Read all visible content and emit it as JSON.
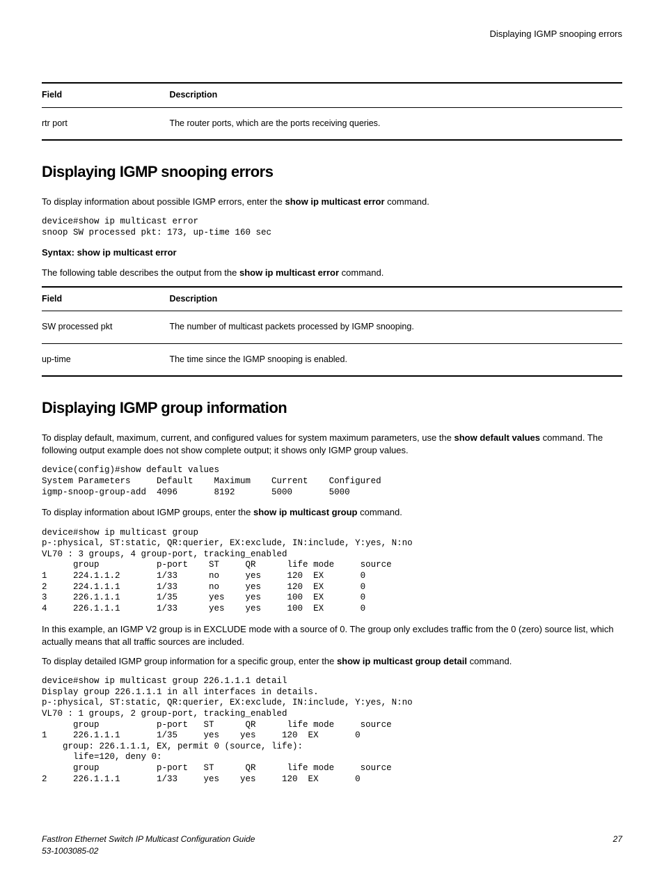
{
  "header": {
    "title": "Displaying IGMP snooping errors"
  },
  "table1": {
    "h1": "Field",
    "h2": "Description",
    "r1c1": "rtr port",
    "r1c2": "The router ports, which are the ports receiving queries."
  },
  "section1": {
    "heading": "Displaying IGMP snooping errors",
    "p1a": "To display information about possible IGMP errors, enter the ",
    "p1b": "show ip multicast error",
    "p1c": " command.",
    "code1": "device#show ip multicast error\nsnoop SW processed pkt: 173, up-time 160 sec",
    "syntax": "Syntax: show ip multicast error",
    "p2a": "The following table describes the output from the ",
    "p2b": "show ip multicast error",
    "p2c": " command."
  },
  "table2": {
    "h1": "Field",
    "h2": "Description",
    "r1c1": "SW processed pkt",
    "r1c2": "The number of multicast packets processed by IGMP snooping.",
    "r2c1": "up-time",
    "r2c2": "The time since the IGMP snooping is enabled."
  },
  "section2": {
    "heading": "Displaying IGMP group information",
    "p1a": "To display default, maximum, current, and configured values for system maximum parameters, use the ",
    "p1b": "show default values",
    "p1c": " command. The following output example does not show complete output; it shows only IGMP group values.",
    "code1": "device(config)#show default values\nSystem Parameters     Default    Maximum    Current    Configured\nigmp-snoop-group-add  4096       8192       5000       5000",
    "p2a": "To display information about IGMP groups, enter the ",
    "p2b": "show ip multicast group",
    "p2c": " command.",
    "code2": "device#show ip multicast group\np-:physical, ST:static, QR:querier, EX:exclude, IN:include, Y:yes, N:no\nVL70 : 3 groups, 4 group-port, tracking_enabled\n      group           p-port    ST     QR      life mode     source\n1     224.1.1.2       1/33      no     yes     120  EX       0\n2     224.1.1.1       1/33      no     yes     120  EX       0\n3     226.1.1.1       1/35      yes    yes     100  EX       0\n4     226.1.1.1       1/33      yes    yes     100  EX       0",
    "p3": "In this example, an IGMP V2 group is in EXCLUDE mode with a source of 0. The group only excludes traffic from the 0 (zero) source list, which actually means that all traffic sources are included.",
    "p4a": "To display detailed IGMP group information for a specific group, enter the ",
    "p4b": "show ip multicast group detail",
    "p4c": " command.",
    "code3": "device#show ip multicast group 226.1.1.1 detail\nDisplay group 226.1.1.1 in all interfaces in details.\np-:physical, ST:static, QR:querier, EX:exclude, IN:include, Y:yes, N:no\nVL70 : 1 groups, 2 group-port, tracking_enabled\n      group           p-port   ST      QR      life mode     source\n1     226.1.1.1       1/35     yes    yes     120  EX       0\n    group: 226.1.1.1, EX, permit 0 (source, life):\n      life=120, deny 0:\n      group           p-port   ST      QR      life mode     source\n2     226.1.1.1       1/33     yes    yes     120  EX       0"
  },
  "footer": {
    "left1": "FastIron Ethernet Switch IP Multicast Configuration Guide",
    "left2": "53-1003085-02",
    "right": "27"
  }
}
